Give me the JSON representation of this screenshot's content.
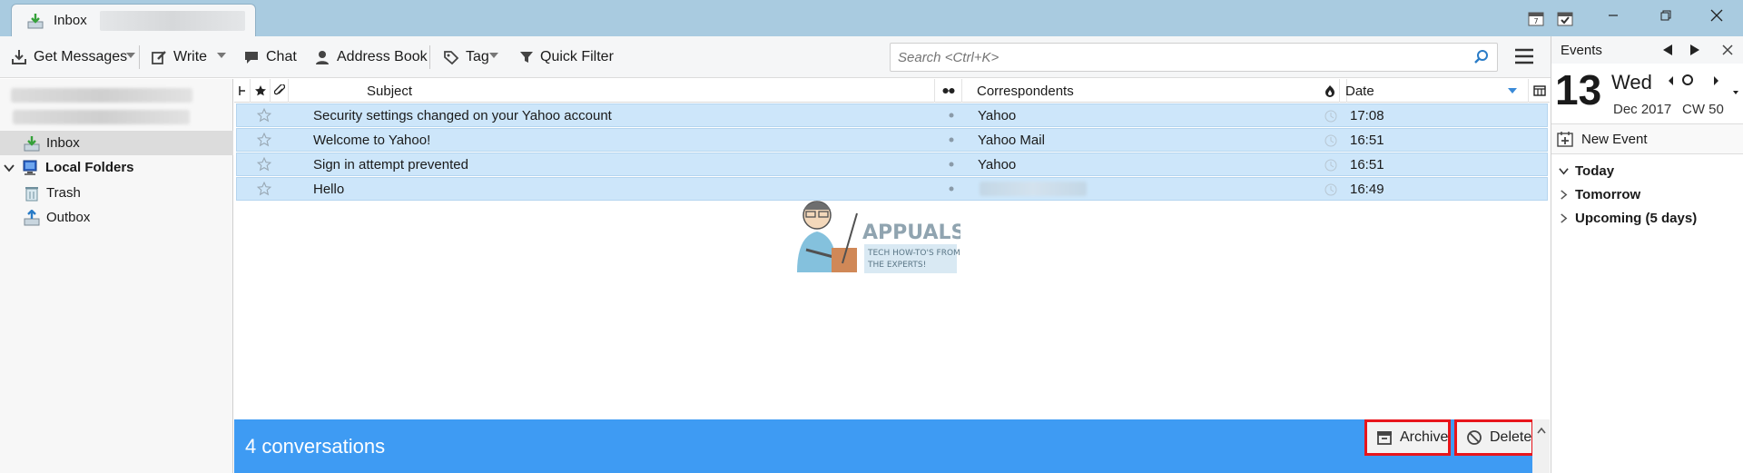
{
  "tab": {
    "label": "Inbox"
  },
  "toolbar": {
    "get_messages": "Get Messages",
    "write": "Write",
    "chat": "Chat",
    "address_book": "Address Book",
    "tag": "Tag",
    "quick_filter": "Quick Filter"
  },
  "search": {
    "placeholder": "Search <Ctrl+K>"
  },
  "folders": {
    "inbox": "Inbox",
    "local_folders": "Local Folders",
    "trash": "Trash",
    "outbox": "Outbox"
  },
  "columns": {
    "subject": "Subject",
    "correspondents": "Correspondents",
    "date": "Date"
  },
  "messages": [
    {
      "subject": "Security settings changed on your Yahoo account",
      "correspondent": "Yahoo",
      "date": "17:08"
    },
    {
      "subject": "Welcome to Yahoo!",
      "correspondent": "Yahoo Mail",
      "date": "16:51"
    },
    {
      "subject": "Sign in attempt prevented",
      "correspondent": "Yahoo",
      "date": "16:51"
    },
    {
      "subject": "Hello",
      "correspondent": "",
      "date": "16:49"
    }
  ],
  "watermark": {
    "brand": "APPUALS",
    "tagline1": "TECH HOW-TO'S FROM",
    "tagline2": "THE EXPERTS!"
  },
  "summary": {
    "text": "4 conversations",
    "archive": "Archive",
    "delete": "Delete"
  },
  "events": {
    "title": "Events",
    "day": "13",
    "weekday": "Wed",
    "month_year": "Dec 2017",
    "week": "CW 50",
    "new_event": "New Event",
    "today": "Today",
    "tomorrow": "Tomorrow",
    "upcoming": "Upcoming (5 days)"
  },
  "colors": {
    "selection": "#cde6fa",
    "summary_bar": "#3e9bf3",
    "titlebar": "#a9cbe0",
    "highlight": "#e8151b"
  }
}
